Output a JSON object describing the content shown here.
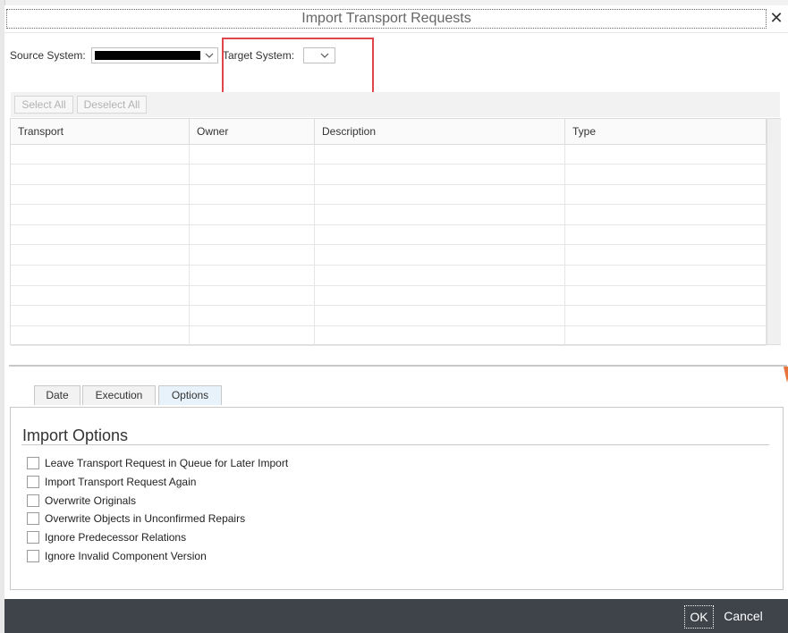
{
  "dialog": {
    "title": "Import Transport Requests"
  },
  "source": {
    "label": "Source System:"
  },
  "target": {
    "label": "Target System:"
  },
  "toolbar": {
    "select_all": "Select All",
    "deselect_all": "Deselect All"
  },
  "table": {
    "columns": [
      "Transport",
      "Owner",
      "Description",
      "Type"
    ]
  },
  "tabs": [
    {
      "label": "Date"
    },
    {
      "label": "Execution"
    },
    {
      "label": "Options"
    }
  ],
  "options": {
    "title": "Import Options",
    "items": [
      {
        "label": "Leave Transport Request in Queue for Later Import",
        "checked": false
      },
      {
        "label": "Import Transport Request Again",
        "checked": false
      },
      {
        "label": "Overwrite Originals",
        "checked": false
      },
      {
        "label": "Overwrite Objects in Unconfirmed Repairs",
        "checked": false
      },
      {
        "label": "Ignore Predecessor Relations",
        "checked": false
      },
      {
        "label": "Ignore Invalid Component Version",
        "checked": false
      }
    ]
  },
  "footer": {
    "ok": "OK",
    "cancel": "Cancel"
  },
  "colors": {
    "highlight": "#e0454a",
    "footer_bg": "#3f434a",
    "active_tab": "#e8f2fa"
  }
}
